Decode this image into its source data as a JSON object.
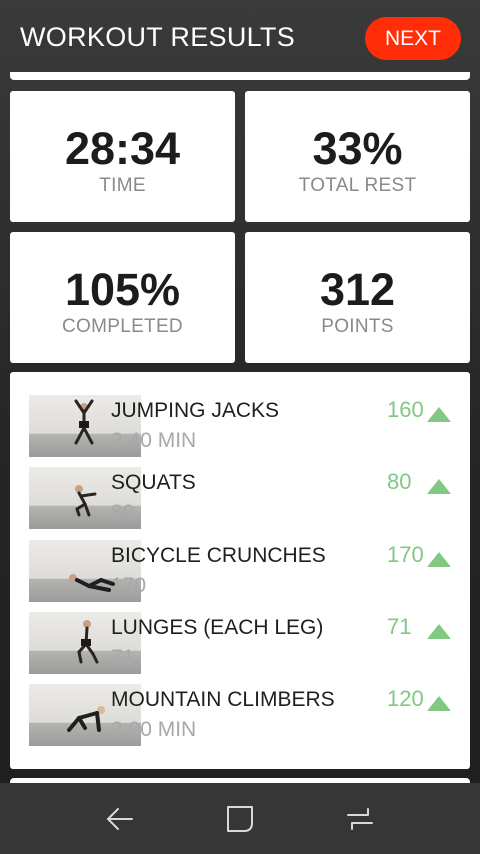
{
  "header": {
    "title": "WORKOUT RESULTS",
    "next_label": "NEXT"
  },
  "stats": [
    {
      "value": "28:34",
      "label": "TIME"
    },
    {
      "value": "33%",
      "label": "TOTAL REST"
    },
    {
      "value": "105%",
      "label": "COMPLETED"
    },
    {
      "value": "312",
      "label": "POINTS"
    }
  ],
  "exercises": [
    {
      "name": "JUMPING JACKS",
      "detail": "2:40 MIN",
      "points": "160"
    },
    {
      "name": "SQUATS",
      "detail": "80",
      "points": "80"
    },
    {
      "name": "BICYCLE CRUNCHES",
      "detail": "170",
      "points": "170"
    },
    {
      "name": "LUNGES (EACH LEG)",
      "detail": "71",
      "points": "71"
    },
    {
      "name": "MOUNTAIN CLIMBERS",
      "detail": "2:00 MIN",
      "points": "120"
    }
  ],
  "colors": {
    "accent": "#ff2d08",
    "points_green": "#82c882",
    "background": "#2b2b2b"
  },
  "navbar": {
    "icons": [
      "back-icon",
      "home-icon",
      "recents-icon"
    ]
  }
}
